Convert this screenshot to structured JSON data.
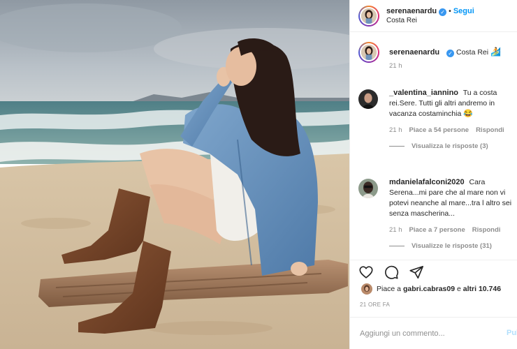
{
  "photo": {
    "description_icon": "beach-photo"
  },
  "header": {
    "username": "serenaenardu",
    "verified_icon": "verified-badge-icon",
    "separator": "•",
    "follow_label": "Segui",
    "location": "Costa Rei"
  },
  "caption": {
    "username": "serenaenardu",
    "text": "Costa Rei",
    "emoji": "🏄",
    "time": "21 h"
  },
  "comments": [
    {
      "username": "_valentina_iannino",
      "text": "Tu a costa rei.Sere. Tutti gli altri andremo in vacanza costaminchia",
      "emoji": "😂",
      "time": "21 h",
      "likes": "Piace a 54 persone",
      "reply_label": "Rispondi",
      "view_replies": "Visualizza le risposte (3)"
    },
    {
      "username": "mdanielafalconi2020",
      "text": "Cara Serena...mi pare che al mare non vi potevi neanche al mare...tra l altro sei senza mascherina...",
      "emoji": "",
      "time": "21 h",
      "likes": "Piace a 7 persone",
      "reply_label": "Rispondi",
      "view_replies": "Visualizze le risposte (31)"
    }
  ],
  "actions": {
    "like_icon": "heart-icon",
    "comment_icon": "comment-bubble-icon",
    "share_icon": "paper-plane-icon"
  },
  "likes": {
    "prefix": "Piace a",
    "user": "gabri.cabras09",
    "middle": "e",
    "others": "altri 10.746"
  },
  "timestamp": "21 ORE FA",
  "add_comment": {
    "placeholder": "Aggiungi un commento...",
    "publish_label": "Pubblica"
  },
  "colors": {
    "accent": "#0095f6",
    "verified": "#3897f0",
    "muted": "#8e8e8e",
    "text": "#262626"
  }
}
